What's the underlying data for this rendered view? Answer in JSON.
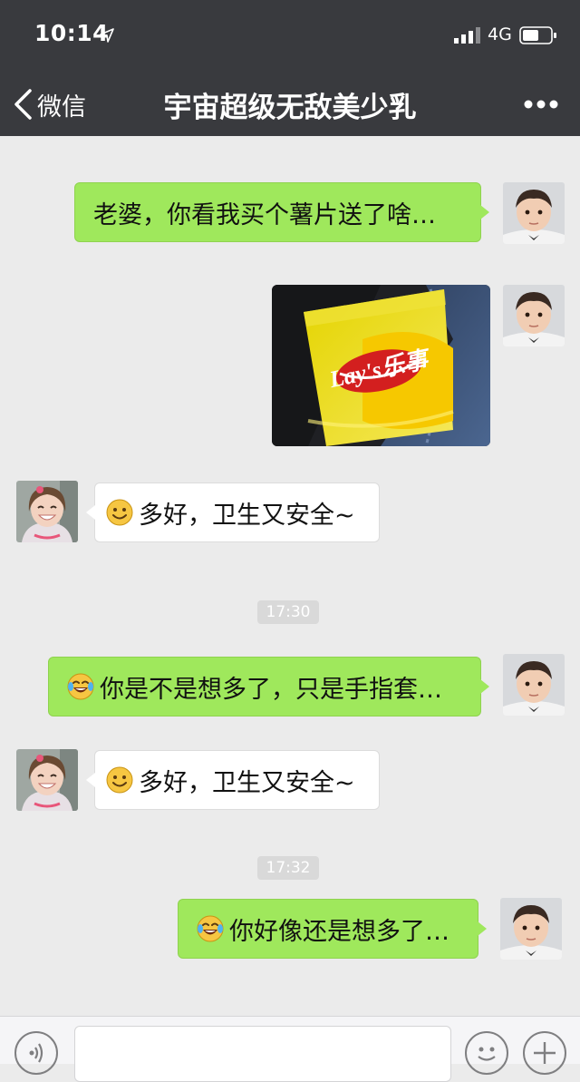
{
  "status_bar": {
    "time": "10:14",
    "network": "4G"
  },
  "nav": {
    "back_label": "微信",
    "title": "宇宙超级无敌美少乳"
  },
  "messages": [
    {
      "from": "me",
      "type": "text",
      "text": "老婆，你看我买个薯片送了啥…"
    },
    {
      "from": "me",
      "type": "image",
      "image_text": "Lay's乐事"
    },
    {
      "from": "other",
      "type": "text",
      "emoji": "smile-emoji",
      "text": "多好，卫生又安全~"
    },
    {
      "type": "timestamp",
      "text": "17:30"
    },
    {
      "from": "me",
      "type": "text",
      "emoji": "tears-of-joy-emoji",
      "text": "你是不是想多了，只是手指套…"
    },
    {
      "from": "other",
      "type": "text",
      "emoji": "smile-emoji",
      "text": "多好，卫生又安全~"
    },
    {
      "type": "timestamp",
      "text": "17:32"
    },
    {
      "from": "me",
      "type": "text",
      "emoji": "tears-of-joy-emoji",
      "text": "你好像还是想多了…"
    }
  ],
  "colors": {
    "header_bg": "#393a3e",
    "chat_bg": "#ebebeb",
    "my_bubble": "#9fe85c",
    "other_bubble": "#ffffff"
  }
}
